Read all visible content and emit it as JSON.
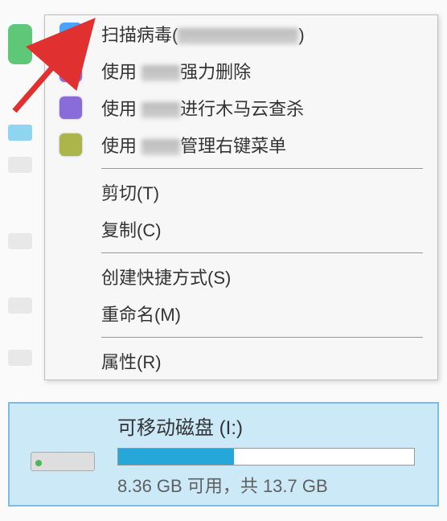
{
  "menu": {
    "scan_virus_prefix": "扫描病毒(",
    "scan_virus_suffix": ")",
    "use_force_delete_prefix": "使用",
    "use_force_delete_suffix": "强力删除",
    "use_trojan_scan_prefix": "使用",
    "use_trojan_scan_suffix": "进行木马云查杀",
    "use_manage_menu_prefix": "使用",
    "use_manage_menu_suffix": "管理右键菜单",
    "cut": "剪切(T)",
    "copy": "复制(C)",
    "create_shortcut": "创建快捷方式(S)",
    "rename": "重命名(M)",
    "properties": "属性(R)"
  },
  "drive": {
    "title": "可移动磁盘 (I:)",
    "stats": "8.36 GB 可用，共 13.7 GB",
    "used_percent": 39
  }
}
